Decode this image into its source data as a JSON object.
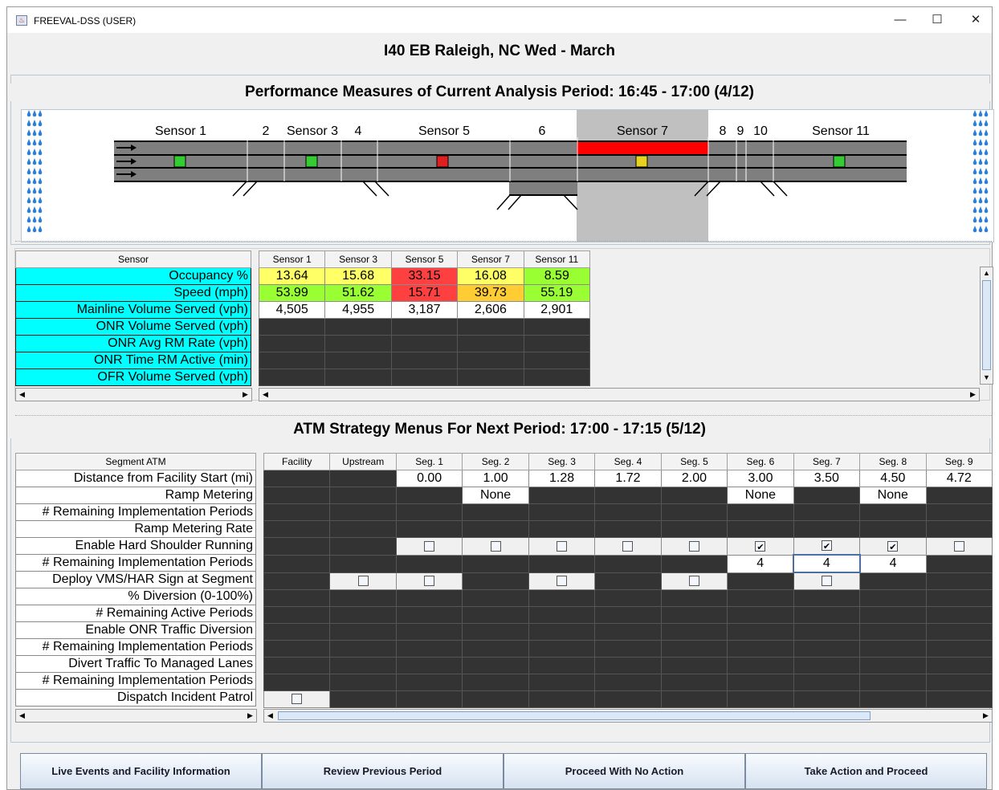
{
  "window": {
    "title": "FREEVAL-DSS (USER)",
    "minimize": "—",
    "maximize": "☐",
    "close": "✕"
  },
  "facility_header": "I40 EB   Raleigh, NC   Wed - March",
  "performance": {
    "title": "Performance Measures of Current Analysis Period: 16:45 - 17:00   (4/12)",
    "diagram_labels": [
      "Sensor 1",
      "2",
      "Sensor 3",
      "4",
      "Sensor 5",
      "6",
      "Sensor 7",
      "8",
      "9",
      "10",
      "Sensor 11"
    ],
    "sensor_table": {
      "corner_header": "Sensor",
      "columns": [
        "Sensor 1",
        "Sensor 3",
        "Sensor 5",
        "Sensor 7",
        "Sensor 11"
      ],
      "rows": [
        {
          "label": "Occupancy %",
          "values": [
            "13.64",
            "15.68",
            "33.15",
            "16.08",
            "8.59"
          ],
          "colors": [
            "#ffff66",
            "#ffff66",
            "#ff4040",
            "#ffff66",
            "#99ff33"
          ]
        },
        {
          "label": "Speed (mph)",
          "values": [
            "53.99",
            "51.62",
            "15.71",
            "39.73",
            "55.19"
          ],
          "colors": [
            "#99ff33",
            "#99ff33",
            "#ff4040",
            "#ffcc33",
            "#99ff33"
          ]
        },
        {
          "label": "Mainline Volume Served (vph)",
          "values": [
            "4,505",
            "4,955",
            "3,187",
            "2,606",
            "2,901"
          ],
          "colors": [
            "#ffffff",
            "#ffffff",
            "#ffffff",
            "#ffffff",
            "#ffffff"
          ]
        },
        {
          "label": "ONR Volume Served (vph)",
          "values": [
            "",
            "",
            "",
            "",
            ""
          ],
          "colors": []
        },
        {
          "label": "ONR Avg RM Rate (vph)",
          "values": [
            "",
            "",
            "",
            "",
            ""
          ],
          "colors": []
        },
        {
          "label": "ONR Time RM Active (min)",
          "values": [
            "",
            "",
            "",
            "",
            ""
          ],
          "colors": []
        },
        {
          "label": "OFR Volume Served (vph)",
          "values": [
            "",
            "",
            "",
            "",
            ""
          ],
          "colors": []
        }
      ]
    }
  },
  "atm": {
    "title": "ATM Strategy Menus For Next Period:   17:00 - 17:15   (5/12)",
    "corner_header": "Segment ATM",
    "columns": [
      "Facility",
      "Upstream",
      "Seg. 1",
      "Seg. 2",
      "Seg. 3",
      "Seg. 4",
      "Seg. 5",
      "Seg. 6",
      "Seg. 7",
      "Seg. 8",
      "Seg. 9"
    ],
    "rows": [
      {
        "label": "Distance from Facility Start (mi)",
        "cells": [
          "d",
          "d",
          "0.00",
          "1.00",
          "1.28",
          "1.72",
          "2.00",
          "3.00",
          "3.50",
          "4.50",
          "4.72"
        ]
      },
      {
        "label": "Ramp Metering",
        "cells": [
          "d",
          "d",
          "d",
          "None",
          "d",
          "d",
          "d",
          "None",
          "d",
          "None",
          "d"
        ]
      },
      {
        "label": "# Remaining Implementation Periods",
        "cells": [
          "d",
          "d",
          "d",
          "d",
          "d",
          "d",
          "d",
          "d",
          "d",
          "d",
          "d"
        ]
      },
      {
        "label": "Ramp Metering Rate",
        "cells": [
          "d",
          "d",
          "d",
          "d",
          "d",
          "d",
          "d",
          "d",
          "d",
          "d",
          "d"
        ]
      },
      {
        "label": "Enable Hard Shoulder Running",
        "cells": [
          "d",
          "d",
          "cb0",
          "cb0",
          "cb0",
          "cb0",
          "cb0",
          "cb1",
          "cb1",
          "cb1",
          "cb0"
        ]
      },
      {
        "label": "# Remaining Implementation Periods",
        "cells": [
          "d",
          "d",
          "d",
          "d",
          "d",
          "d",
          "d",
          "4",
          "4",
          "4",
          "d"
        ]
      },
      {
        "label": "Deploy VMS/HAR Sign at Segment",
        "cells": [
          "d",
          "cb0",
          "cb0",
          "d",
          "cb0",
          "d",
          "cb0",
          "d",
          "cb0",
          "d",
          "d"
        ]
      },
      {
        "label": "% Diversion (0-100%)",
        "cells": [
          "d",
          "d",
          "d",
          "d",
          "d",
          "d",
          "d",
          "d",
          "d",
          "d",
          "d"
        ]
      },
      {
        "label": "# Remaining Active Periods",
        "cells": [
          "d",
          "d",
          "d",
          "d",
          "d",
          "d",
          "d",
          "d",
          "d",
          "d",
          "d"
        ]
      },
      {
        "label": "Enable ONR Traffic Diversion",
        "cells": [
          "d",
          "d",
          "d",
          "d",
          "d",
          "d",
          "d",
          "d",
          "d",
          "d",
          "d"
        ]
      },
      {
        "label": "# Remaining Implementation Periods",
        "cells": [
          "d",
          "d",
          "d",
          "d",
          "d",
          "d",
          "d",
          "d",
          "d",
          "d",
          "d"
        ]
      },
      {
        "label": "Divert Traffic To Managed Lanes",
        "cells": [
          "d",
          "d",
          "d",
          "d",
          "d",
          "d",
          "d",
          "d",
          "d",
          "d",
          "d"
        ]
      },
      {
        "label": "# Remaining Implementation Periods",
        "cells": [
          "d",
          "d",
          "d",
          "d",
          "d",
          "d",
          "d",
          "d",
          "d",
          "d",
          "d"
        ]
      },
      {
        "label": "Dispatch Incident Patrol",
        "cells": [
          "cb0",
          "d",
          "d",
          "d",
          "d",
          "d",
          "d",
          "d",
          "d",
          "d",
          "d"
        ]
      }
    ]
  },
  "buttons": [
    "Live Events and Facility Information",
    "Review Previous Period",
    "Proceed With No Action",
    "Take Action and Proceed"
  ],
  "colors": {
    "congested": "#ff0000",
    "sensor_green": "#33cc33",
    "sensor_yellow": "#e6d21f",
    "sensor_red": "#e02020",
    "highlight_gray": "#c0c0c0",
    "label_cyan": "#00ffff"
  }
}
